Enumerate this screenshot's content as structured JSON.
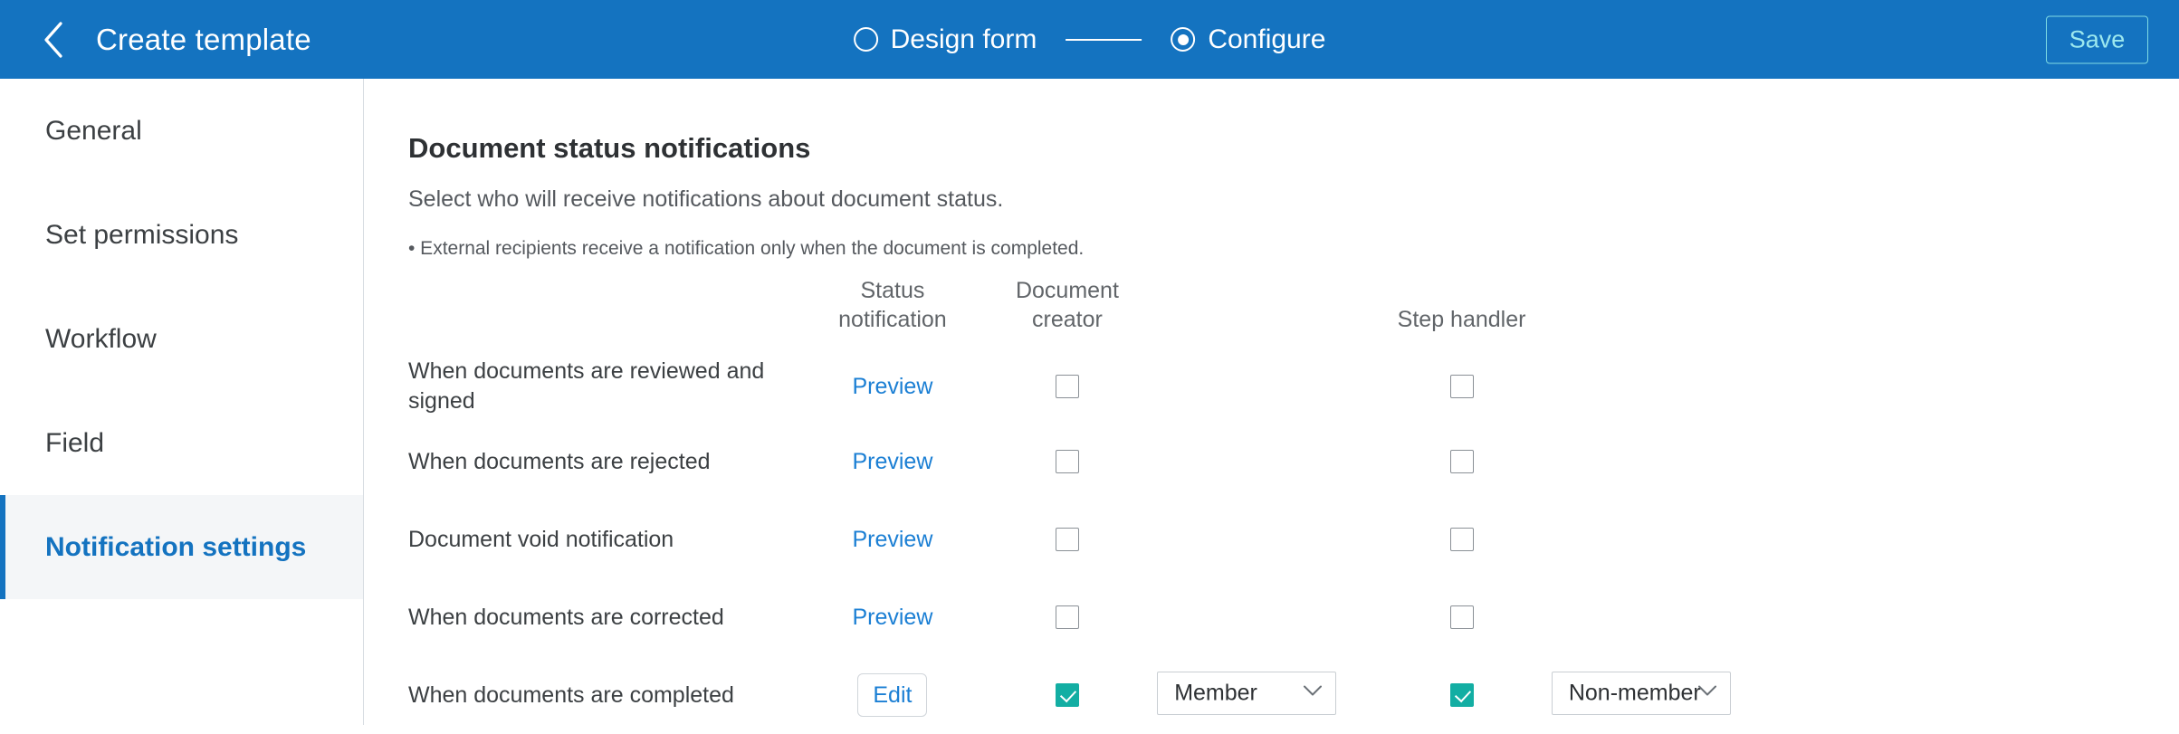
{
  "topbar": {
    "back_icon": "chevron-left-icon",
    "title": "Create template",
    "save_label": "Save",
    "steps": [
      {
        "label": "Design form",
        "selected": false
      },
      {
        "label": "Configure",
        "selected": true
      }
    ]
  },
  "sidebar": {
    "items": [
      {
        "label": "General",
        "active": false
      },
      {
        "label": "Set permissions",
        "active": false
      },
      {
        "label": "Workflow",
        "active": false
      },
      {
        "label": "Field",
        "active": false
      },
      {
        "label": "Notification settings",
        "active": true
      }
    ]
  },
  "main": {
    "title": "Document status notifications",
    "subtitle": "Select who will receive notifications about document status.",
    "note": "• External recipients receive a notification only when the document is completed.",
    "table": {
      "headers": {
        "label": "",
        "status_notification": "Status\nnotification",
        "status_notification_line1": "Status",
        "status_notification_line2": "notification",
        "document_creator": "Document\ncreator",
        "document_creator_line1": "Document",
        "document_creator_line2": "creator",
        "step_handler": "Step handler"
      },
      "rows": [
        {
          "label": "When documents are reviewed and signed",
          "action_label": "Preview",
          "action_type": "link",
          "creator_checked": false,
          "creator_select": null,
          "handler_checked": false,
          "handler_select": null
        },
        {
          "label": "When documents are rejected",
          "action_label": "Preview",
          "action_type": "link",
          "creator_checked": false,
          "creator_select": null,
          "handler_checked": false,
          "handler_select": null
        },
        {
          "label": "Document void notification",
          "action_label": "Preview",
          "action_type": "link",
          "creator_checked": false,
          "creator_select": null,
          "handler_checked": false,
          "handler_select": null
        },
        {
          "label": "When documents are corrected",
          "action_label": "Preview",
          "action_type": "link",
          "creator_checked": false,
          "creator_select": null,
          "handler_checked": false,
          "handler_select": null
        },
        {
          "label": "When documents are completed",
          "action_label": "Edit",
          "action_type": "button",
          "creator_checked": true,
          "creator_select": "Member",
          "handler_checked": true,
          "handler_select": "Non-member"
        }
      ]
    }
  },
  "colors": {
    "brand_blue": "#1473c0",
    "link_blue": "#1b7fd4",
    "checkbox_teal": "#13aea3",
    "save_border": "#7fdbe4",
    "active_bg": "#f4f6f8"
  }
}
